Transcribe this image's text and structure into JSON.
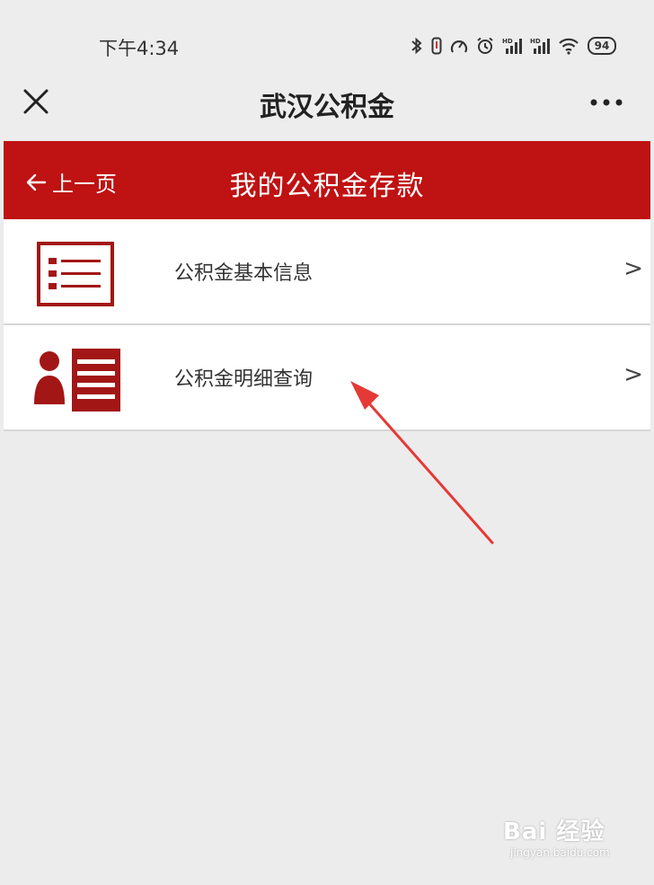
{
  "status_bar": {
    "time": "下午4:34",
    "battery": "94",
    "icons": [
      "bluetooth-icon",
      "vibrate-icon",
      "gauge-icon",
      "alarm-icon",
      "signal-hd-icon",
      "signal-hd-icon",
      "wifi-icon",
      "battery-icon"
    ]
  },
  "title_bar": {
    "title": "武汉公积金",
    "close_icon": "close-icon",
    "more_icon": "more-dots-icon"
  },
  "header": {
    "back_label": "上一页",
    "page_title": "我的公积金存款",
    "color": "#bf1212"
  },
  "menu": {
    "items": [
      {
        "label": "公积金基本信息",
        "icon": "info-list-icon",
        "chevron": ">"
      },
      {
        "label": "公积金明细查询",
        "icon": "person-detail-icon",
        "chevron": ">"
      }
    ]
  },
  "watermark": {
    "logo": "Bai 经验",
    "url": "jingyan.baidu.com"
  },
  "colors": {
    "accent": "#bf1212",
    "annotation_arrow": "#e53935",
    "background": "#ececec"
  }
}
